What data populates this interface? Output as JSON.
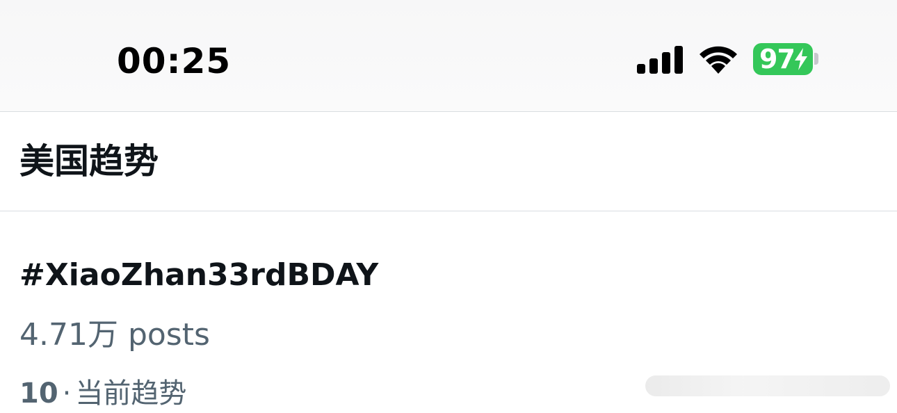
{
  "status_bar": {
    "time": "00:25",
    "battery_level": "97",
    "battery_color": "#34c759",
    "icons": [
      "signal-icon",
      "wifi-icon",
      "battery-icon",
      "charging-bolt-icon"
    ]
  },
  "header": {
    "title": "美国趋势"
  },
  "trend": {
    "tag": "#XiaoZhan33rdBDAY",
    "count": "4.71万 posts",
    "rank": "10",
    "separator": "·",
    "category": "当前趋势"
  },
  "colors": {
    "primary_text": "#0f1419",
    "secondary_text": "#536471",
    "divider": "#d9dde1"
  }
}
